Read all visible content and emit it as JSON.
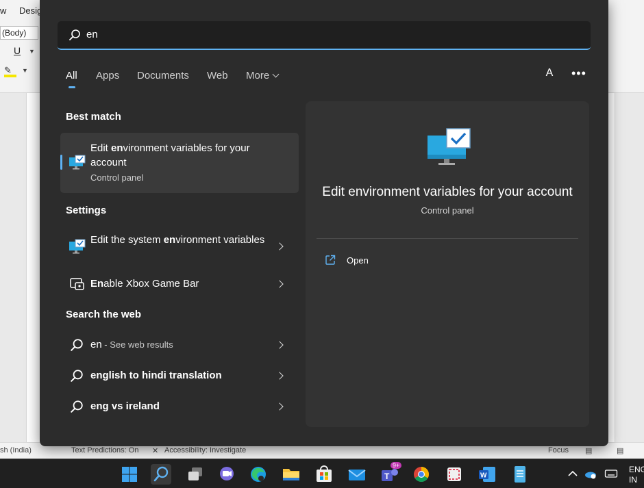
{
  "background": {
    "word_tabs": [
      "w",
      "Desig"
    ],
    "font_name": "(Body)",
    "underline_label": "U",
    "status_language": "sh (India)",
    "status_text_predictions": "Text Predictions: On",
    "status_accessibility": "Accessibility: Investigate",
    "status_focus": "Focus"
  },
  "search": {
    "query": "en",
    "accent_color": "#5fb2f2"
  },
  "filters": {
    "all": "All",
    "apps": "Apps",
    "documents": "Documents",
    "web": "Web",
    "more": "More",
    "account_initial": "A",
    "more_options": "•••"
  },
  "sections": {
    "best_match": "Best match",
    "settings": "Settings",
    "search_web": "Search the web"
  },
  "best_match": {
    "title_pre": "Edit ",
    "title_bold": "en",
    "title_post": "vironment variables for your account",
    "subtitle": "Control panel",
    "icon": "monitor-check-icon"
  },
  "settings_results": [
    {
      "title_pre": "Edit the system ",
      "title_bold": "en",
      "title_post": "vironment variables",
      "icon": "monitor-check-icon"
    },
    {
      "title_pre": "",
      "title_bold": "En",
      "title_post": "able Xbox Game Bar",
      "icon": "xbox-gamebar-icon"
    }
  ],
  "web_results": [
    {
      "query": "en",
      "suffix": " - See web results",
      "icon": "search-icon"
    },
    {
      "query_bold": "english to hindi translation",
      "icon": "search-icon"
    },
    {
      "query_bold": "eng vs ireland",
      "icon": "search-icon"
    }
  ],
  "preview": {
    "title": "Edit environment variables for your account",
    "subtitle": "Control panel",
    "action_open": "Open",
    "icon": "monitor-check-icon"
  },
  "taskbar": {
    "apps": [
      "windows-start-icon",
      "search-icon",
      "task-view-icon",
      "teams-chat-icon",
      "edge-icon",
      "file-explorer-icon",
      "microsoft-store-icon",
      "mail-icon",
      "teams-icon",
      "chrome-icon",
      "snipping-tool-icon",
      "word-icon",
      "notepad-icon"
    ],
    "teams_badge": "9+",
    "language_line1": "ENG",
    "language_line2": "IN"
  }
}
